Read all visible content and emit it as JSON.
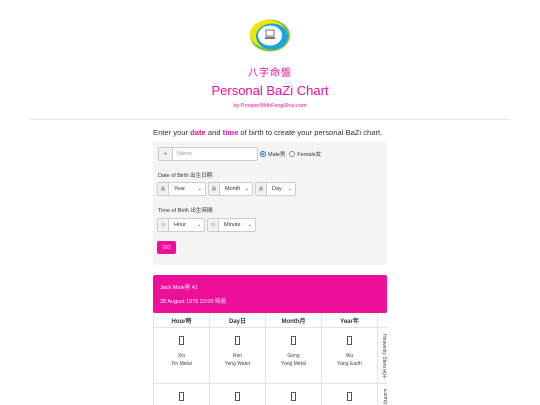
{
  "header": {
    "chinese_title": "八字命盤",
    "title": "Personal BaZi Chart",
    "byline": "by ProsperWithFengShui.com"
  },
  "logo": {
    "icon": "bazi-logo-icon",
    "colors": [
      "#f5e600",
      "#7dc142",
      "#1ba5e0"
    ]
  },
  "intro": {
    "prefix": "Enter your ",
    "date_word": "date",
    "and": " and ",
    "time_word": "time",
    "suffix": " of birth to create your personal BaZi chart."
  },
  "form": {
    "name": {
      "icon": "user-icon",
      "placeholder": "Name",
      "value": ""
    },
    "gender": {
      "options": [
        {
          "label": "Male男",
          "selected": true
        },
        {
          "label": "Female女",
          "selected": false
        }
      ]
    },
    "dob_label": "Date of Birth 出生日期:",
    "year": {
      "icon": "calendar-icon",
      "value": "Year"
    },
    "month": {
      "icon": "calendar-icon",
      "value": "Month"
    },
    "day": {
      "icon": "calendar-icon",
      "value": "Day"
    },
    "tob_label": "Time of Birth 出生時間:",
    "hour": {
      "icon": "clock-icon",
      "value": "Hour"
    },
    "minute": {
      "icon": "clock-icon",
      "value": "Minute"
    },
    "go_label": "GO"
  },
  "result": {
    "line1": "Jack  Male男  41",
    "line2": "28 August 1978  22:00  時辰"
  },
  "chart_table": {
    "columns": [
      "Hour時",
      "Day日",
      "Month月",
      "Year年"
    ],
    "stem_label": "Heavenly Stem 天干",
    "branch_label": "Earthly Branch",
    "stems": [
      {
        "glyph": "辛",
        "pinyin": "Xin",
        "element": "Yin Metal"
      },
      {
        "glyph": "壬",
        "pinyin": "Ren",
        "element": "Yang Water"
      },
      {
        "glyph": "庚",
        "pinyin": "Geng",
        "element": "Yang Metal"
      },
      {
        "glyph": "戊",
        "pinyin": "Wu",
        "element": "Yang Earth"
      }
    ]
  },
  "colors": {
    "accent": "#ee0f9a",
    "panel": "#f4f4f4"
  }
}
